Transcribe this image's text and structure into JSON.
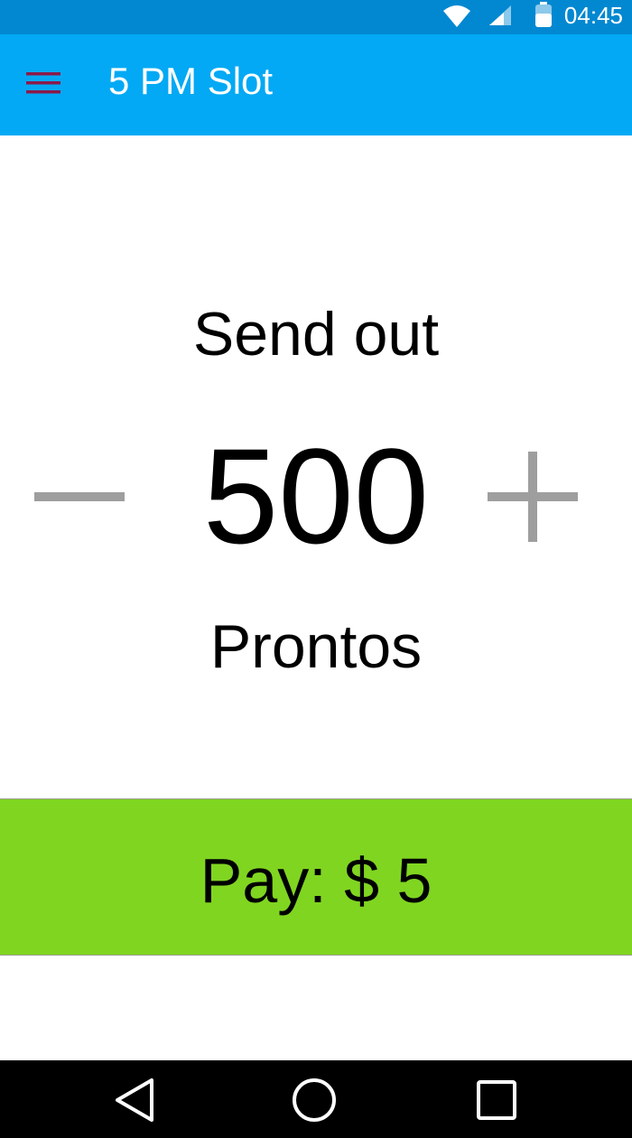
{
  "status_bar": {
    "time": "04:45",
    "icons": [
      "wifi-icon",
      "cell-signal-icon",
      "battery-icon"
    ],
    "color": "#0288d1"
  },
  "app_bar": {
    "title": "5 PM Slot",
    "menu_icon": "hamburger-menu-icon",
    "menu_icon_color": "#8b1a4a",
    "color": "#03a9f4"
  },
  "sender": {
    "prefix_label": "Send out",
    "count": "500",
    "unit_label": "Prontos",
    "decrement_icon": "minus-icon",
    "increment_icon": "plus-icon",
    "stepper_color": "#9e9e9e"
  },
  "pay": {
    "label": "Pay: $ 5",
    "color": "#80d521"
  },
  "nav_bar": {
    "buttons": [
      "back-icon",
      "home-icon",
      "recents-icon"
    ]
  }
}
